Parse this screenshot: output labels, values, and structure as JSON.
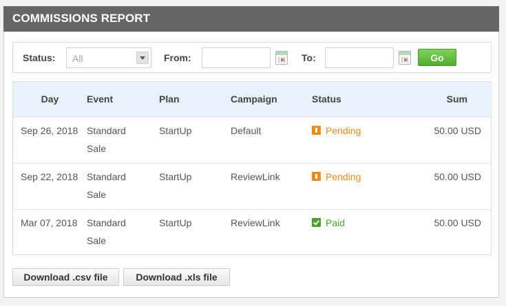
{
  "header": {
    "title": "COMMISSIONS REPORT"
  },
  "filters": {
    "status_label": "Status:",
    "status_value": "All",
    "from_label": "From:",
    "from_value": "",
    "to_label": "To:",
    "to_value": "",
    "go_label": "Go"
  },
  "table": {
    "columns": [
      "Day",
      "Event",
      "Plan",
      "Campaign",
      "Status",
      "Sum"
    ],
    "rows": [
      {
        "day": "Sep 26, 2018",
        "event_line1": "Standard",
        "event_line2": "Sale",
        "plan": "StartUp",
        "campaign": "Default",
        "status": "Pending",
        "sum": "50.00 USD"
      },
      {
        "day": "Sep 22, 2018",
        "event_line1": "Standard",
        "event_line2": "Sale",
        "plan": "StartUp",
        "campaign": "ReviewLink",
        "status": "Pending",
        "sum": "50.00 USD"
      },
      {
        "day": "Mar 07, 2018",
        "event_line1": "Standard",
        "event_line2": "Sale",
        "plan": "StartUp",
        "campaign": "ReviewLink",
        "status": "Paid",
        "sum": "50.00 USD"
      }
    ]
  },
  "downloads": {
    "csv_label": "Download .csv file",
    "xls_label": "Download .xls file"
  },
  "colors": {
    "header_bg": "#666666",
    "pending": "#f0891a",
    "paid": "#4aa02a",
    "go_button": "#5cbf36",
    "table_header_bg": "#e9f2fa"
  }
}
